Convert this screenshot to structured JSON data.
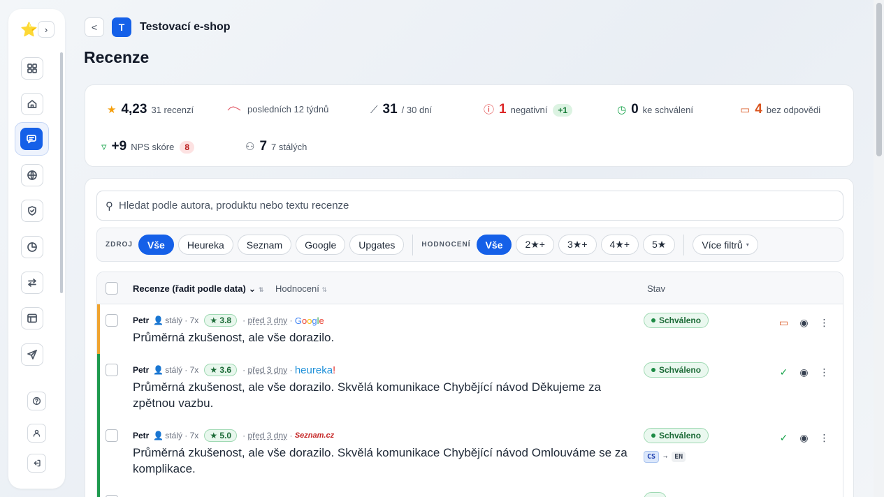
{
  "header": {
    "back": "<",
    "shop_initial": "T",
    "shop_name": "Testovací e-shop",
    "page_title": "Recenze"
  },
  "stats": {
    "rating": "4,23",
    "rating_count": "31 recenzí",
    "trend_label": "posledních 12 týdnů",
    "recent": "31",
    "recent_label": "/ 30 dní",
    "negative": "1",
    "negative_label": "negativní",
    "negative_delta": "+1",
    "pending": "0",
    "pending_label": "ke schválení",
    "unanswered": "4",
    "unanswered_label": "bez odpovědi",
    "nps": "+9",
    "nps_label": "NPS skóre",
    "nps_badge": "8",
    "regulars": "7",
    "regulars_label": "7 stálých"
  },
  "search": {
    "placeholder": "Hledat podle autora, produktu nebo textu recenze"
  },
  "filters": {
    "source_label": "ZDROJ",
    "sources": [
      "Vše",
      "Heureka",
      "Seznam",
      "Google",
      "Upgates"
    ],
    "rating_label": "HODNOCENÍ",
    "ratings": [
      "Vše",
      "2★+",
      "3★+",
      "4★+",
      "5★"
    ],
    "more": "Více filtrů"
  },
  "table": {
    "col_review": "Recenze (řadit podle data)",
    "col_rating": "Hodnocení",
    "col_status": "Stav",
    "rows": [
      {
        "author": "Petr",
        "tag": "stálý · 7x",
        "rating": "3.8",
        "when": "před 3 dny",
        "source": "Google",
        "text": "Průměrná zkušenost, ale vše dorazilo.",
        "status": "Schváleno"
      },
      {
        "author": "Petr",
        "tag": "stálý · 7x",
        "rating": "3.6",
        "when": "před 3 dny",
        "source": "heureka!",
        "text": "Průměrná zkušenost, ale vše dorazilo. Skvělá komunikace Chybějící návod Děkujeme za zpětnou vazbu.",
        "status": "Schváleno"
      },
      {
        "author": "Petr",
        "tag": "stálý · 7x",
        "rating": "5.0",
        "when": "před 3 dny",
        "source": "Seznam.cz",
        "text": "Průměrná zkušenost, ale vše dorazilo. Skvělá komunikace Chybějící návod Omlouváme se za komplikace.",
        "status": "Schváleno",
        "lang_from": "CS",
        "lang_to": "EN"
      }
    ]
  },
  "colors": {
    "accent": "#1560e8",
    "approved": "#1c8a44",
    "warning_bar": "#f0a430",
    "success_bar": "#1f9a4e"
  }
}
